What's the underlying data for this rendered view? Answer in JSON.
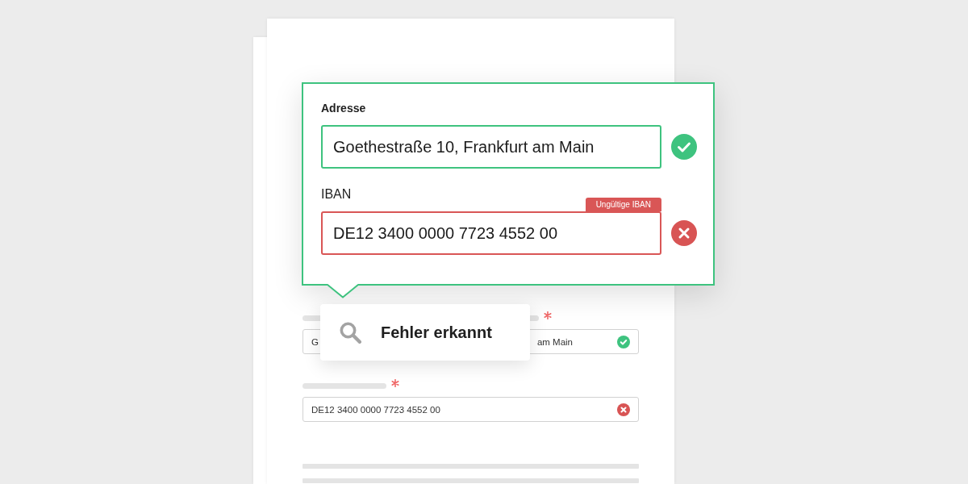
{
  "popover": {
    "fields": [
      {
        "label": "Adresse",
        "emphasized": true,
        "value": "Goethestraße 10, Frankfurt am Main",
        "valid": true
      },
      {
        "label": "IBAN",
        "emphasized": false,
        "error": "Ungültige IBAN",
        "value": "DE12 3400 0000 7723 4552 00",
        "valid": false
      }
    ]
  },
  "tooltip": {
    "text": "Fehler erkannt"
  },
  "form": {
    "fields": [
      {
        "required": true,
        "value_parts": [
          "G",
          "am Main"
        ],
        "valid": true
      },
      {
        "required": true,
        "value_parts": [
          "DE12 3400 0000 7723 4552 00"
        ],
        "valid": false
      }
    ]
  }
}
